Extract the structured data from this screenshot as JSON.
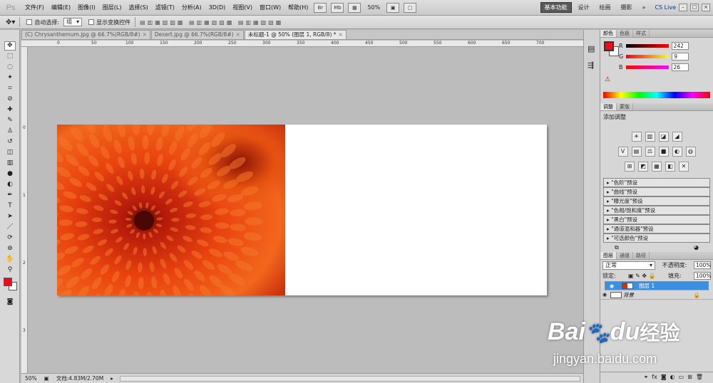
{
  "app": {
    "logo": "Ps"
  },
  "menus": [
    "文件(F)",
    "编辑(E)",
    "图像(I)",
    "图层(L)",
    "选择(S)",
    "滤镜(T)",
    "分析(A)",
    "3D(D)",
    "视图(V)",
    "窗口(W)",
    "帮助(H)"
  ],
  "toolbar_btns": [
    "Br",
    "Mb"
  ],
  "zoom": "50%",
  "workspaces": [
    "基本功能",
    "设计",
    "绘画",
    "摄影"
  ],
  "more": "»",
  "cslive": "CS Live",
  "options": {
    "auto_select_label": "自动选择:",
    "auto_select_value": "组",
    "show_transform_label": "显示变换控件"
  },
  "tabs": [
    {
      "label": "(C) Chrysanthemum.jpg @ 66.7%(RGB/8#)",
      "close": "×"
    },
    {
      "label": "Desert.jpg @ 66.7%(RGB/8#)",
      "close": "×"
    },
    {
      "label": "未标题-1 @ 50% (图层 1, RGB/8) *",
      "close": "×"
    }
  ],
  "ruler_top": [
    "0",
    "50",
    "100",
    "150",
    "200",
    "250",
    "300",
    "350",
    "400",
    "450",
    "500",
    "550",
    "600",
    "650",
    "700"
  ],
  "ruler_left": [
    "0",
    "1",
    "2",
    "3"
  ],
  "status": {
    "zoom": "50%",
    "doc": "文档:4.83M/2.70M"
  },
  "color_panel": {
    "tabs": [
      "颜色",
      "色板",
      "样式"
    ],
    "r_label": "R",
    "g_label": "G",
    "b_label": "B",
    "r": "242",
    "g": "9",
    "b": "26",
    "fg": "#f2091a"
  },
  "adjust_panel": {
    "tabs": [
      "调整",
      "蒙版"
    ],
    "title": "添加调整",
    "icons1": [
      "☀",
      "▥",
      "◪",
      "◢"
    ],
    "icons2": [
      "V",
      "▤",
      "⚖",
      "■",
      "◐",
      "◍"
    ],
    "icons3": [
      "⊞",
      "◩",
      "▦",
      "◧",
      "✕"
    ],
    "presets": [
      "\"色阶\"预设",
      "\"曲线\"预设",
      "\"曝光度\"预设",
      "\"色相/饱和度\"预设",
      "\"黑白\"预设",
      "\"通道混和器\"预设",
      "\"可选颜色\"预设"
    ]
  },
  "layers_panel": {
    "tabs": [
      "图层",
      "通道",
      "路径"
    ],
    "blend": "正常",
    "opacity_label": "不透明度:",
    "opacity": "100%",
    "lock_label": "锁定:",
    "fill_label": "填充:",
    "fill": "100%",
    "layers": [
      {
        "name": "图层 1",
        "selected": true
      },
      {
        "name": "背景",
        "selected": false
      }
    ]
  },
  "watermark": {
    "brand": "Bai",
    "brand2": "du",
    "cn": "经验",
    "url": "jingyan.baidu.com"
  }
}
